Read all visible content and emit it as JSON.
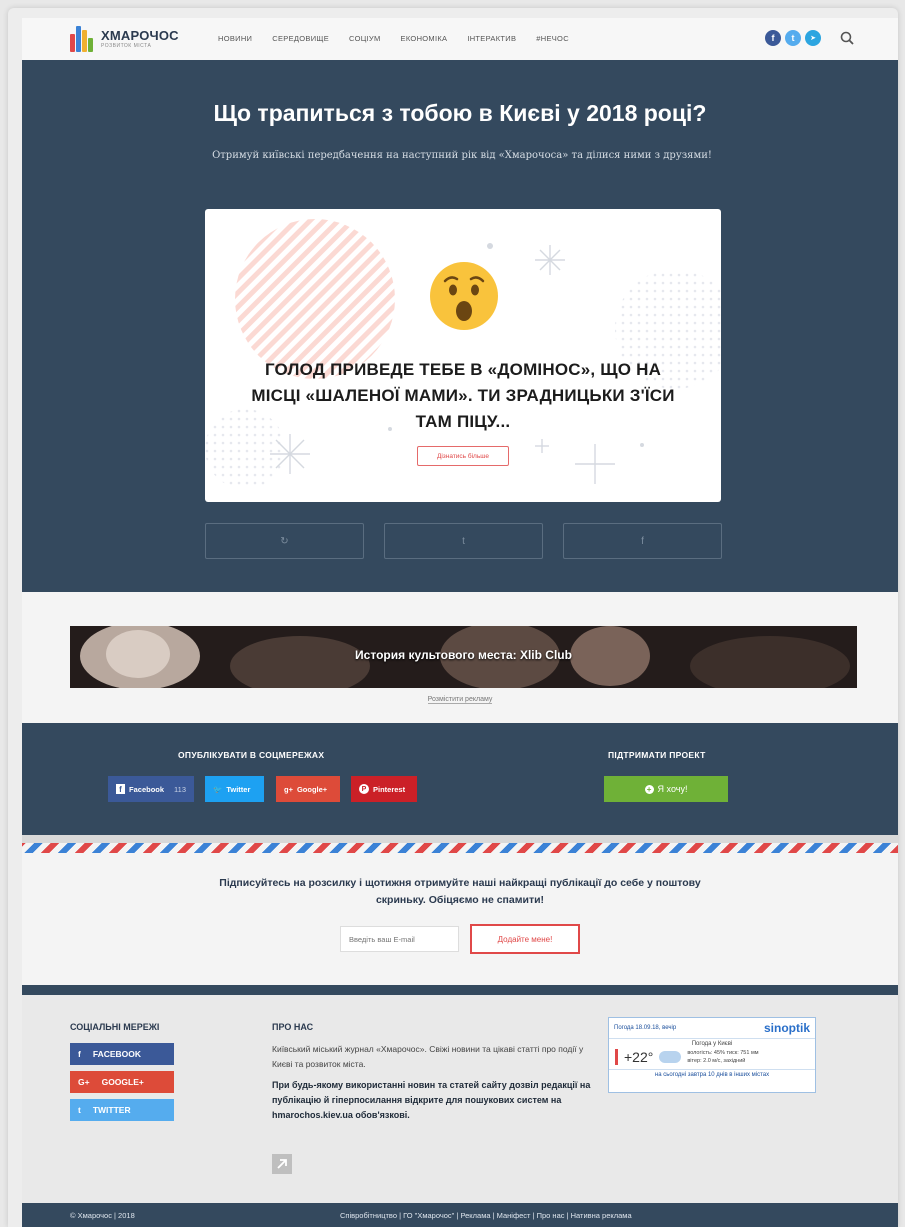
{
  "header": {
    "logo_title": "ХМАРОЧОС",
    "logo_sub": "РОЗВИТОК МІСТА",
    "nav": [
      "НОВИНИ",
      "СЕРЕДОВИЩЕ",
      "СОЦІУМ",
      "ЕКОНОМІКА",
      "ІНТЕРАКТИВ",
      "#НЕЧОС"
    ],
    "social": [
      "f",
      "t",
      "➤"
    ]
  },
  "hero": {
    "title": "Що трапиться з тобою в Києві у 2018 році?",
    "subtitle": "Отримуй київські передбачення на наступний рік від «Хмарочоса» та ділися ними з друзями!",
    "card_text": "ГОЛОД ПРИВЕДЕ ТЕБЕ В «ДОМІНОС», ЩО НА МІСЦІ «ШАЛЕНОЇ МАМИ». ТИ ЗРАДНИЦЬКИ З'ЇСИ ТАМ ПІЦУ...",
    "card_button": "Дізнатись більше",
    "actions": [
      "↻",
      "t",
      "f"
    ]
  },
  "ad": {
    "text": "История культового места: Xlib Club",
    "place_ad": "Розмістити рекламу"
  },
  "share": {
    "heading": "ОПУБЛІКУВАТИ В СОЦМЕРЕЖАХ",
    "facebook": "Facebook",
    "facebook_count": "113",
    "twitter": "Twitter",
    "google": "Google+",
    "pinterest": "Pinterest",
    "support_heading": "ПІДТРИМАТИ ПРОЕКТ",
    "support_button": "Я хочу!"
  },
  "newsletter": {
    "text": "Підписуйтесь на розсилку і щотижня отримуйте наші найкращі публікації до себе у поштову скриньку. Обіцяємо не спамити!",
    "placeholder": "Введіть ваш E-mail",
    "button": "Додайте мене!"
  },
  "footer": {
    "social_heading": "СОЦІАЛЬНІ МЕРЕЖІ",
    "social": [
      {
        "icon": "f",
        "label": "FACEBOOK",
        "color": "#3b5998"
      },
      {
        "icon": "G+",
        "label": "GOOGLE+",
        "color": "#dd4b39"
      },
      {
        "icon": "t",
        "label": "TWITTER",
        "color": "#55acee"
      }
    ],
    "about_heading": "ПРО НАС",
    "about_text": "Київський міський журнал «Хмарочос». Свіжі новини та цікаві статті про події у Києві та розвиток міста.",
    "about_bold": "При будь-якому використанні новин та статей сайту дозвіл редакції на публікацію й гіперпосилання відкрите для пошукових систем на hmarochos.kiev.ua обов'язкові.",
    "weather": {
      "header": "Погода 18.09.18, вечір",
      "brand": "sinoptik",
      "city": "Погода у Києві",
      "temp": "+22°",
      "humidity": "вологість: 45% тиск: 751 мм",
      "wind": "вітер: 2.0 м/с, західний",
      "links": "на сьогодні  завтра  10 днів  в інших містах"
    }
  },
  "copyright": {
    "left": "© Хмарочос | 2018",
    "links": "Співробітництво | ГО \"Хмарочос\" | Реклама | Маніфест | Про нас | Нативна реклама"
  }
}
